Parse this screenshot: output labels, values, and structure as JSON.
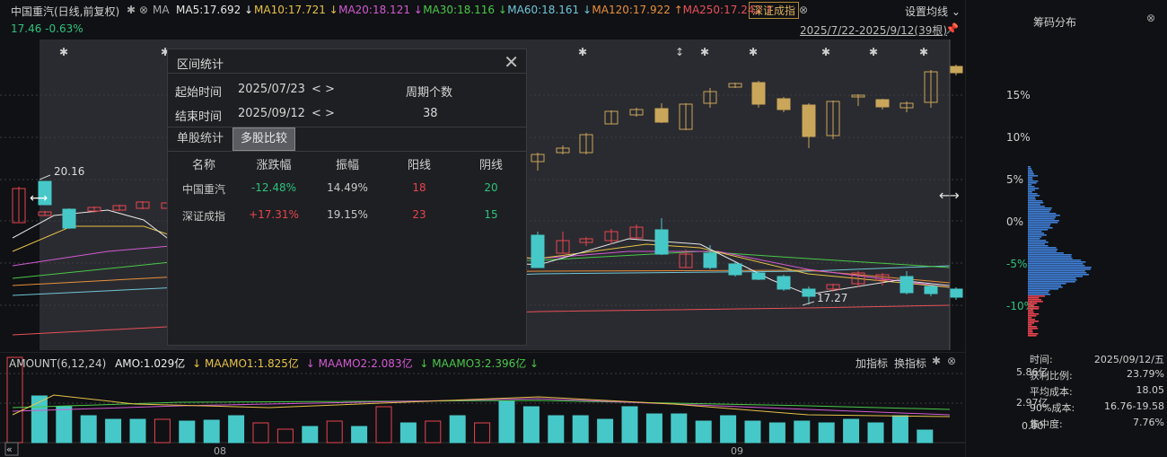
{
  "header": {
    "stock": "中国重汽(日线,前复权)",
    "ma_label": "MA",
    "ma": [
      {
        "label": "MA5:17.692",
        "arrow": "↓",
        "color": "#e6e6e6"
      },
      {
        "label": "MA10:17.721",
        "arrow": "↓",
        "color": "#e6c24a"
      },
      {
        "label": "MA20:18.121",
        "arrow": "↓",
        "color": "#d25ad2"
      },
      {
        "label": "MA30:18.116",
        "arrow": "↓",
        "color": "#4ac84a"
      },
      {
        "label": "MA60:18.161",
        "arrow": "↓",
        "color": "#6fc6d8"
      },
      {
        "label": "MA120:17.922",
        "arrow": "↑",
        "color": "#e8903c"
      },
      {
        "label": "MA250:17.242",
        "arrow": "↑",
        "color": "#e8505a"
      }
    ],
    "index_tag": "深证成指",
    "settings": "设置均线",
    "price_change": "17.46 -0.63%",
    "date_range": "2025/7/22-2025/9/12(39根)"
  },
  "chart_labels": {
    "high": "20.16",
    "low": "17.27"
  },
  "y_axis": [
    "15%",
    "10%",
    "5%",
    "0%",
    "-5%",
    "-10%"
  ],
  "stats_panel": {
    "title": "区间统计",
    "start_label": "起始时间",
    "start_value": "2025/07/23",
    "arrows": "< >",
    "end_label": "结束时间",
    "end_value": "2025/09/12",
    "period_label": "周期个数",
    "period_value": "38",
    "tab_single": "单股统计",
    "tab_compare": "多股比较",
    "columns": [
      "名称",
      "涨跌幅",
      "振幅",
      "阳线",
      "阴线"
    ],
    "rows": [
      {
        "name": "中国重汽",
        "change": "-12.48%",
        "amp": "14.49%",
        "up": "18",
        "down": "20"
      },
      {
        "name": "深证成指",
        "change": "+17.31%",
        "amp": "19.15%",
        "up": "23",
        "down": "15"
      }
    ]
  },
  "amount_bar": {
    "title": "AMOUNT(6,12,24)",
    "amo": "AMO:1.029亿",
    "m1": "MAAMO1:1.825亿",
    "m2": "MAAMO2:2.083亿",
    "m3": "MAAMO3:2.396亿",
    "add": "加指标",
    "switch": "换指标",
    "scale": [
      "5.86亿",
      "2.97亿",
      "0.00"
    ],
    "months": [
      "08",
      "09"
    ]
  },
  "right": {
    "title": "筹码分布",
    "info": [
      {
        "k": "时间:",
        "v": "2025/09/12/五"
      },
      {
        "k": "获利比例:",
        "v": "23.79%"
      },
      {
        "k": "平均成本:",
        "v": "18.05"
      },
      {
        "k": "90%成本:",
        "v": "16.76-19.58"
      },
      {
        "k": "集中度:",
        "v": "7.76%"
      }
    ]
  },
  "colors": {
    "up": "#e8444f",
    "down": "#46c8c8",
    "index": "#c9a65a"
  }
}
